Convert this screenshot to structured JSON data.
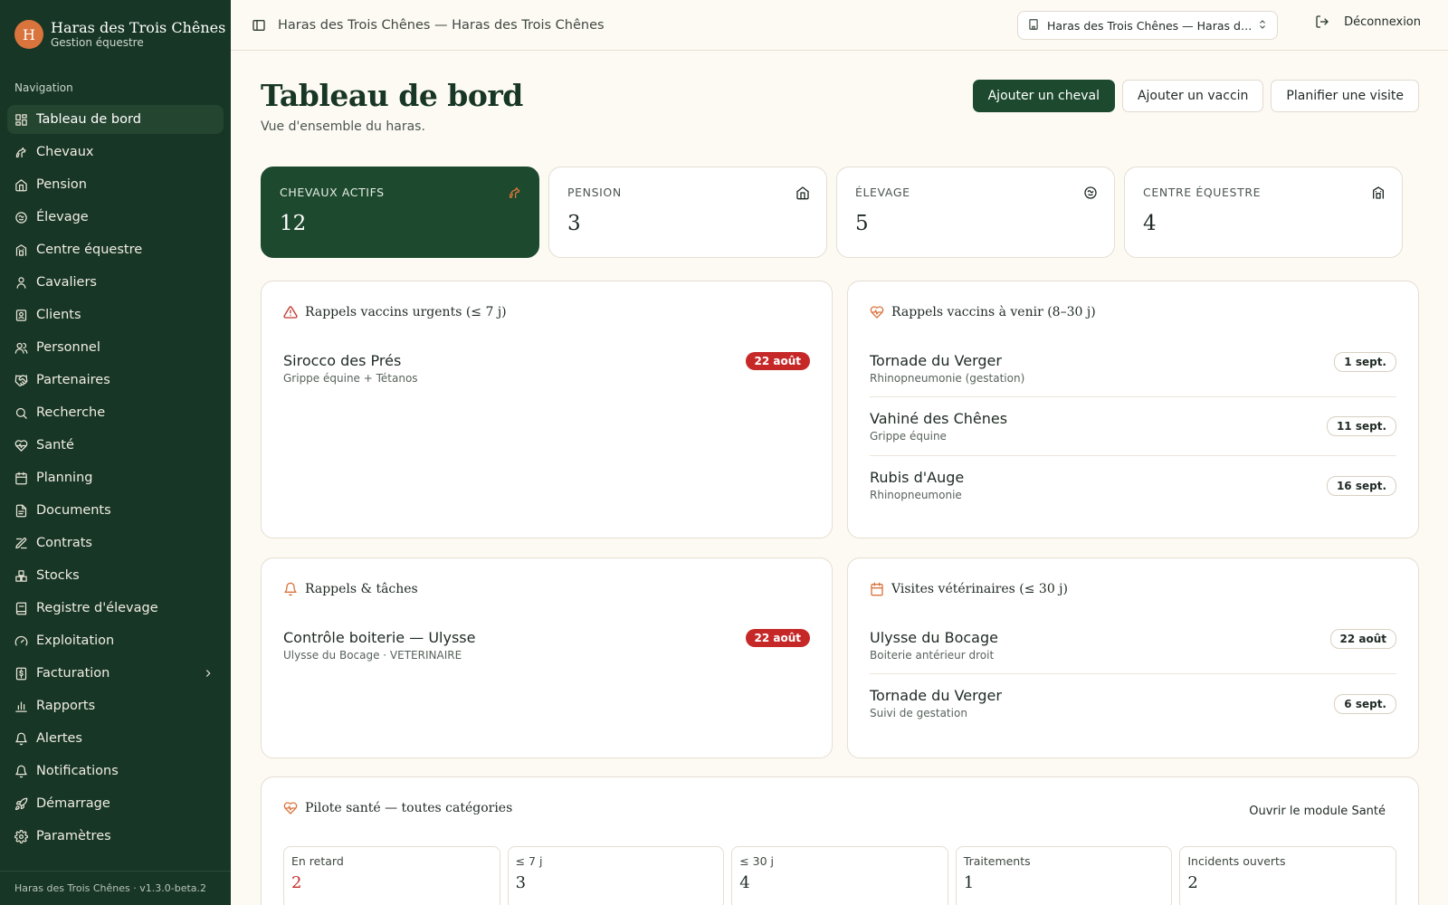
{
  "brand": {
    "initial": "H",
    "name": "Haras des Trois Chênes",
    "subtitle": "Gestion équestre"
  },
  "sidebar": {
    "heading": "Navigation",
    "items": [
      {
        "label": "Tableau de bord",
        "icon": "dashboard-icon",
        "active": true
      },
      {
        "label": "Chevaux",
        "icon": "horse-icon"
      },
      {
        "label": "Pension",
        "icon": "home-icon"
      },
      {
        "label": "Élevage",
        "icon": "breeding-icon"
      },
      {
        "label": "Centre équestre",
        "icon": "building-icon"
      },
      {
        "label": "Cavaliers",
        "icon": "rider-icon"
      },
      {
        "label": "Clients",
        "icon": "contact-icon"
      },
      {
        "label": "Personnel",
        "icon": "users-icon"
      },
      {
        "label": "Partenaires",
        "icon": "handshake-icon"
      },
      {
        "label": "Recherche",
        "icon": "search-icon"
      },
      {
        "label": "Santé",
        "icon": "heart-pulse-icon"
      },
      {
        "label": "Planning",
        "icon": "calendar-icon"
      },
      {
        "label": "Documents",
        "icon": "document-icon"
      },
      {
        "label": "Contrats",
        "icon": "contract-icon"
      },
      {
        "label": "Stocks",
        "icon": "boxes-icon"
      },
      {
        "label": "Registre d'élevage",
        "icon": "register-icon"
      },
      {
        "label": "Exploitation",
        "icon": "gauge-icon"
      },
      {
        "label": "Facturation",
        "icon": "invoice-icon",
        "has_children": true
      },
      {
        "label": "Rapports",
        "icon": "chart-icon"
      },
      {
        "label": "Alertes",
        "icon": "bell-icon"
      },
      {
        "label": "Notifications",
        "icon": "bell-icon"
      },
      {
        "label": "Démarrage",
        "icon": "rocket-icon"
      },
      {
        "label": "Paramètres",
        "icon": "gear-icon"
      }
    ],
    "footer": "Haras des Trois Chênes · v1.3.0-beta.2"
  },
  "topbar": {
    "title": "Haras des Trois Chênes — Haras des Trois Chênes",
    "selector_value": "Haras des Trois Chênes — Haras des Trois Chênes",
    "logout_label": "Déconnexion"
  },
  "page": {
    "title": "Tableau de bord",
    "subtitle": "Vue d'ensemble du haras.",
    "actions": {
      "add_horse": "Ajouter un cheval",
      "add_vaccine": "Ajouter un vaccin",
      "plan_visit": "Planifier une visite"
    }
  },
  "stats": [
    {
      "label": "Chevaux actifs",
      "value": "12",
      "icon": "horse-icon"
    },
    {
      "label": "Pension",
      "value": "3",
      "icon": "home-icon"
    },
    {
      "label": "Élevage",
      "value": "5",
      "icon": "breeding-icon"
    },
    {
      "label": "Centre équestre",
      "value": "4",
      "icon": "building-icon"
    }
  ],
  "urgent_vaccines": {
    "title": "Rappels vaccins urgents (≤ 7 j)",
    "items": [
      {
        "name": "Sirocco des Prés",
        "detail": "Grippe équine + Tétanos",
        "date": "22 août"
      }
    ]
  },
  "upcoming_vaccines": {
    "title": "Rappels vaccins à venir (8–30 j)",
    "items": [
      {
        "name": "Tornade du Verger",
        "detail": "Rhinopneumonie (gestation)",
        "date": "1 sept."
      },
      {
        "name": "Vahiné des Chênes",
        "detail": "Grippe équine",
        "date": "11 sept."
      },
      {
        "name": "Rubis d'Auge",
        "detail": "Rhinopneumonie",
        "date": "16 sept."
      }
    ]
  },
  "reminders": {
    "title": "Rappels & tâches",
    "items": [
      {
        "name": "Contrôle boiterie — Ulysse",
        "detail": "Ulysse du Bocage · VETERINAIRE",
        "date": "22 août"
      }
    ]
  },
  "vet_visits": {
    "title": "Visites vétérinaires (≤ 30 j)",
    "items": [
      {
        "name": "Ulysse du Bocage",
        "detail": "Boiterie antérieur droit",
        "date": "22 août"
      },
      {
        "name": "Tornade du Verger",
        "detail": "Suivi de gestation",
        "date": "6 sept."
      }
    ]
  },
  "health": {
    "title": "Pilote santé — toutes catégories",
    "open_label": "Ouvrir le module Santé",
    "boxes": [
      {
        "label": "En retard",
        "value": "2",
        "alert": true
      },
      {
        "label": "≤ 7 j",
        "value": "3"
      },
      {
        "label": "≤ 30 j",
        "value": "4"
      },
      {
        "label": "Traitements",
        "value": "1"
      },
      {
        "label": "Incidents ouverts",
        "value": "2"
      }
    ]
  },
  "colors": {
    "sidebar_bg": "#173625",
    "primary": "#1d4a2e",
    "accent": "#d9743d",
    "alert": "#c62828",
    "page_bg": "#fdf9f3"
  }
}
